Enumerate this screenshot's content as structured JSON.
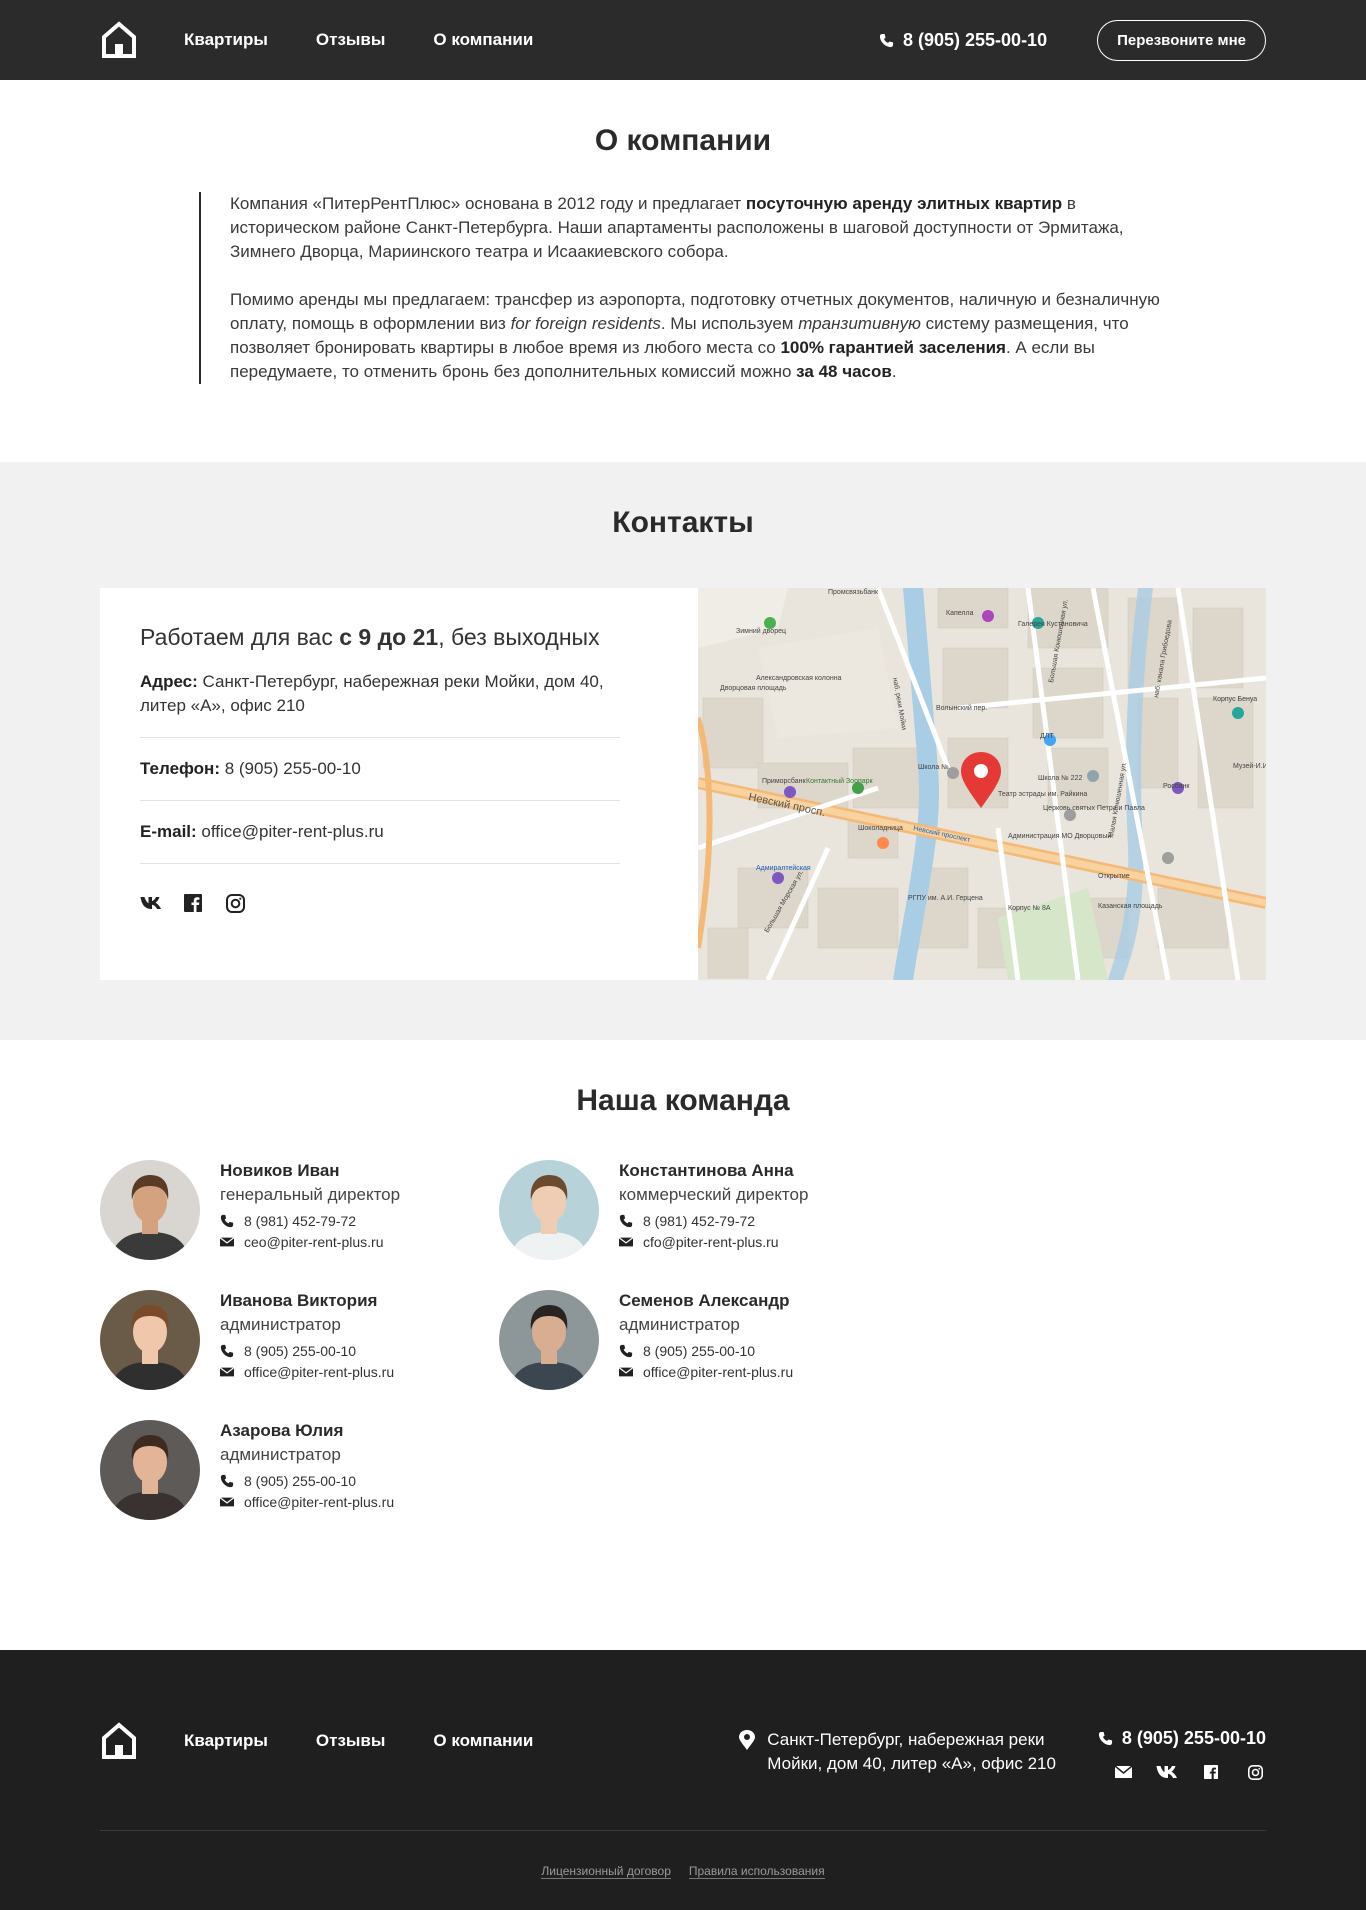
{
  "header": {
    "nav": [
      "Квартиры",
      "Отзывы",
      "О компании"
    ],
    "phone": "8 (905) 255-00-10",
    "callback_label": "Перезвоните мне"
  },
  "about": {
    "title": "О компании",
    "p1": [
      "Компания «ПитерРентПлюс» основана в 2012 году и предлагает ",
      "посуточную аренду элитных квартир",
      " в историческом районе Санкт-Петербурга. Наши апартаменты расположены в шаговой доступности от Эрмитажа, Зимнего Дворца, Мариинского театра и Исаакиевского собора."
    ],
    "p2": [
      "Помимо аренды мы предлагаем: трансфер из аэропорта, подготовку отчетных документов, наличную и безналичную оплату, помощь в оформлении виз ",
      "for foreign residents",
      ". Мы используем ",
      "транзитивную",
      " систему размещения, что позволяет бронировать квартиры в любое время из любого места со ",
      "100% гарантией заселения",
      ". А если вы передумаете, то отменить бронь без дополнительных комиссий можно ",
      "за 48 часов",
      "."
    ]
  },
  "contacts": {
    "title": "Контакты",
    "hours": [
      "Работаем для вас ",
      "с 9 до 21",
      ", без выходных"
    ],
    "address_label": "Адрес:",
    "address": " Санкт-Петербург, набережная реки Мойки, дом 40, литер «А», офис 210",
    "phone_label": "Телефон:",
    "phone": " 8 (905) 255-00-10",
    "email_label": "E-mail:",
    "email": " office@piter-rent-plus.ru",
    "socials": [
      "vk-icon",
      "facebook-icon",
      "instagram-icon"
    ]
  },
  "map": {
    "labels": [
      "Промсвязьбанк",
      "Зимний дворец",
      "Капелла",
      "Галерея Кустановича",
      "Александровская колонна",
      "Дворцовая площадь",
      "наб. реки Мойки",
      "Большая Конюшенная ул.",
      "Волынский пер.",
      "ДЛТ",
      "Школа № 222",
      "Приморсбанк",
      "Контактный Зоопарк",
      "Школа №",
      "Театр эстрады им. Райкина",
      "Церковь святых Петра и Павла",
      "Невский просп.",
      "Шоколадница",
      "Невский проспект",
      "Администрация МО Дворцовый",
      "Адмиралтейская",
      "Открытие",
      "Росбанк",
      "Корпус Бенуа",
      "Музей-И.И. Б",
      "Большая Морская ул.",
      "РГПУ им. А.И. Герцена",
      "Корпус № 8А",
      "Казанская площадь",
      "Малая Конюшенная ул.",
      "наб. канала Грибоедова"
    ]
  },
  "team": {
    "title": "Наша команда",
    "members": [
      {
        "name": "Новиков Иван",
        "role": "генеральный директор",
        "phone": "8 (981) 452-79-72",
        "email": "ceo@piter-rent-plus.ru"
      },
      {
        "name": "Константинова Анна",
        "role": "коммерческий директор",
        "phone": "8 (981) 452-79-72",
        "email": "cfo@piter-rent-plus.ru"
      },
      {
        "name": "Иванова Виктория",
        "role": "администратор",
        "phone": "8 (905) 255-00-10",
        "email": "office@piter-rent-plus.ru"
      },
      {
        "name": "Семенов Александр",
        "role": "администратор",
        "phone": "8 (905) 255-00-10",
        "email": "office@piter-rent-plus.ru"
      },
      {
        "name": "Азарова Юлия",
        "role": "администратор",
        "phone": "8 (905) 255-00-10",
        "email": "office@piter-rent-plus.ru"
      }
    ]
  },
  "footer": {
    "nav": [
      "Квартиры",
      "Отзывы",
      "О компании"
    ],
    "address": "Санкт-Петербург, набережная реки Мойки, дом 40, литер «А», офис 210",
    "phone": "8 (905) 255-00-10",
    "socials": [
      "mail-icon",
      "vk-icon",
      "facebook-icon",
      "instagram-icon"
    ],
    "links": [
      "Лицензионный договор",
      "Правила использования"
    ]
  },
  "colors": {
    "header_bg": "#2b2b2b",
    "footer_bg": "#1f1f1f",
    "section_bg": "#f1f1f1",
    "map_pin": "#e53935"
  }
}
